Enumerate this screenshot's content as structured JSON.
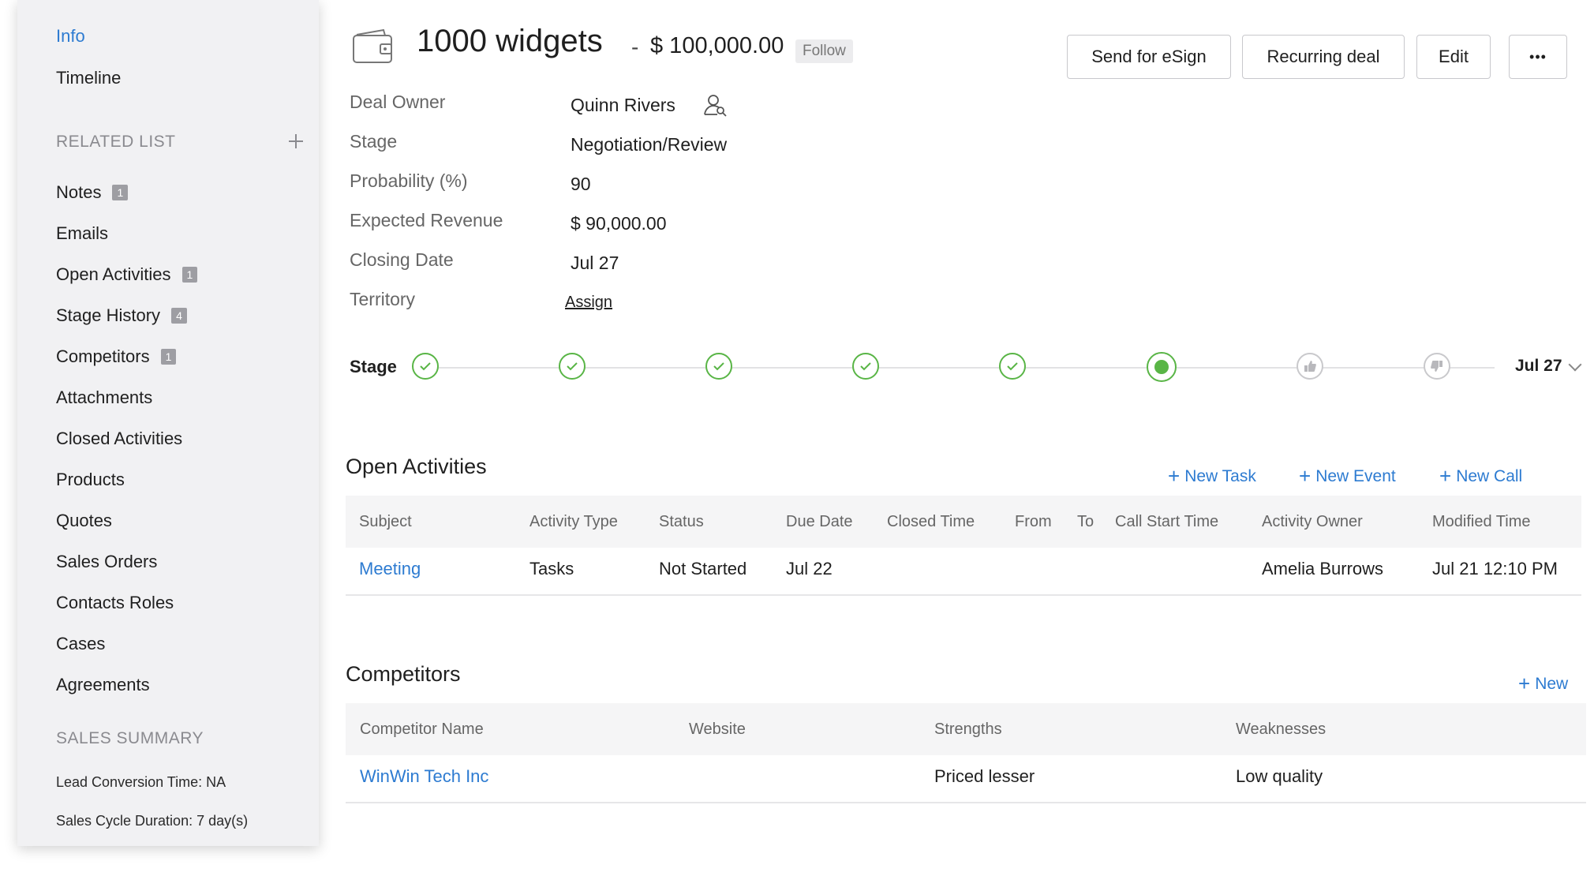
{
  "sidebar": {
    "info": "Info",
    "timeline": "Timeline",
    "related_list_heading": "RELATED LIST",
    "related_items": [
      {
        "label": "Notes",
        "count": "1"
      },
      {
        "label": "Emails",
        "count": ""
      },
      {
        "label": "Open Activities",
        "count": "1"
      },
      {
        "label": "Stage History",
        "count": "4"
      },
      {
        "label": "Competitors",
        "count": "1"
      },
      {
        "label": "Attachments",
        "count": ""
      },
      {
        "label": "Closed Activities",
        "count": ""
      },
      {
        "label": "Products",
        "count": ""
      },
      {
        "label": "Quotes",
        "count": ""
      },
      {
        "label": "Sales Orders",
        "count": ""
      },
      {
        "label": "Contacts Roles",
        "count": ""
      },
      {
        "label": "Cases",
        "count": ""
      },
      {
        "label": "Agreements",
        "count": ""
      }
    ],
    "sales_summary_heading": "SALES SUMMARY",
    "lead_conversion": "Lead Conversion Time: NA",
    "sales_cycle": "Sales Cycle Duration: 7 day(s)"
  },
  "header": {
    "title": "1000 widgets",
    "dash": "-",
    "amount": "$ 100,000.00",
    "follow": "Follow",
    "buttons": {
      "esign": "Send for eSign",
      "recurring": "Recurring deal",
      "edit": "Edit",
      "more": "•••"
    }
  },
  "fields": [
    {
      "label": "Deal Owner",
      "value": "Quinn Rivers"
    },
    {
      "label": "Stage",
      "value": "Negotiation/Review"
    },
    {
      "label": "Probability (%)",
      "value": "90"
    },
    {
      "label": "Expected Revenue",
      "value": "$ 90,000.00"
    },
    {
      "label": "Closing Date",
      "value": "Jul 27"
    },
    {
      "label": "Territory",
      "value": "Assign"
    }
  ],
  "stage_bar": {
    "label": "Stage",
    "date": "Jul 27",
    "completed_stages": 5,
    "current_stage": 6,
    "total_stages": 8
  },
  "open_activities": {
    "title": "Open Activities",
    "actions": [
      "New Task",
      "New Event",
      "New Call"
    ],
    "columns": [
      "Subject",
      "Activity Type",
      "Status",
      "Due Date",
      "Closed Time",
      "From",
      "To",
      "Call Start Time",
      "Activity Owner",
      "Modified Time"
    ],
    "rows": [
      {
        "subject": "Meeting",
        "type": "Tasks",
        "status": "Not Started",
        "due": "Jul 22",
        "owner": "Amelia Burrows",
        "modified": "Jul 21 12:10 PM"
      }
    ]
  },
  "competitors": {
    "title": "Competitors",
    "action": "New",
    "columns": [
      "Competitor Name",
      "Website",
      "Strengths",
      "Weaknesses"
    ],
    "rows": [
      {
        "name": "WinWin Tech Inc",
        "website": "",
        "strengths": "Priced lesser",
        "weaknesses": "Low quality"
      }
    ]
  },
  "colors": {
    "accent": "#2d7bd1",
    "stage_done": "#59b546",
    "sidebar_bg": "#f1f1f3"
  }
}
